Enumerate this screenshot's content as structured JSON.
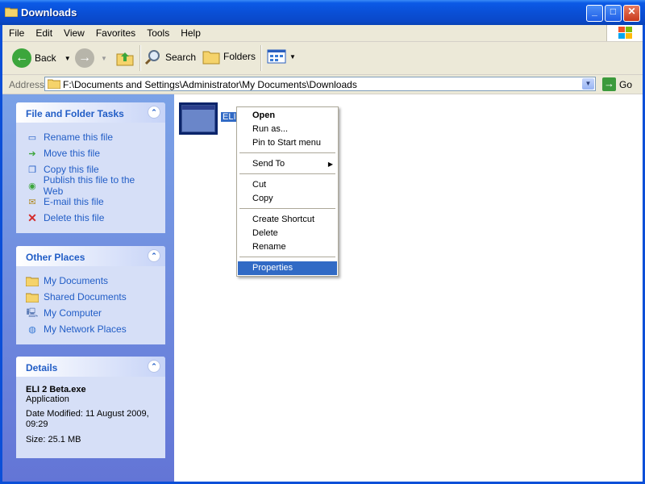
{
  "window": {
    "title": "Downloads"
  },
  "menubar": [
    "File",
    "Edit",
    "View",
    "Favorites",
    "Tools",
    "Help"
  ],
  "toolbar": {
    "back": "Back",
    "search": "Search",
    "folders": "Folders"
  },
  "address": {
    "label": "Address",
    "value": "F:\\Documents and Settings\\Administrator\\My Documents\\Downloads",
    "go": "Go"
  },
  "tasks": {
    "title": "File and Folder Tasks",
    "items": [
      "Rename this file",
      "Move this file",
      "Copy this file",
      "Publish this file to the Web",
      "E-mail this file",
      "Delete this file"
    ]
  },
  "places": {
    "title": "Other Places",
    "items": [
      "My Documents",
      "Shared Documents",
      "My Computer",
      "My Network Places"
    ]
  },
  "details": {
    "title": "Details",
    "name": "ELI 2 Beta.exe",
    "type": "Application",
    "modified": "Date Modified: 11 August 2009, 09:29",
    "size": "Size: 25.1 MB"
  },
  "file": {
    "label": "ELI"
  },
  "context_menu": {
    "open": "Open",
    "run_as": "Run as...",
    "pin": "Pin to Start menu",
    "send_to": "Send To",
    "cut": "Cut",
    "copy": "Copy",
    "create_shortcut": "Create Shortcut",
    "delete": "Delete",
    "rename": "Rename",
    "properties": "Properties"
  }
}
